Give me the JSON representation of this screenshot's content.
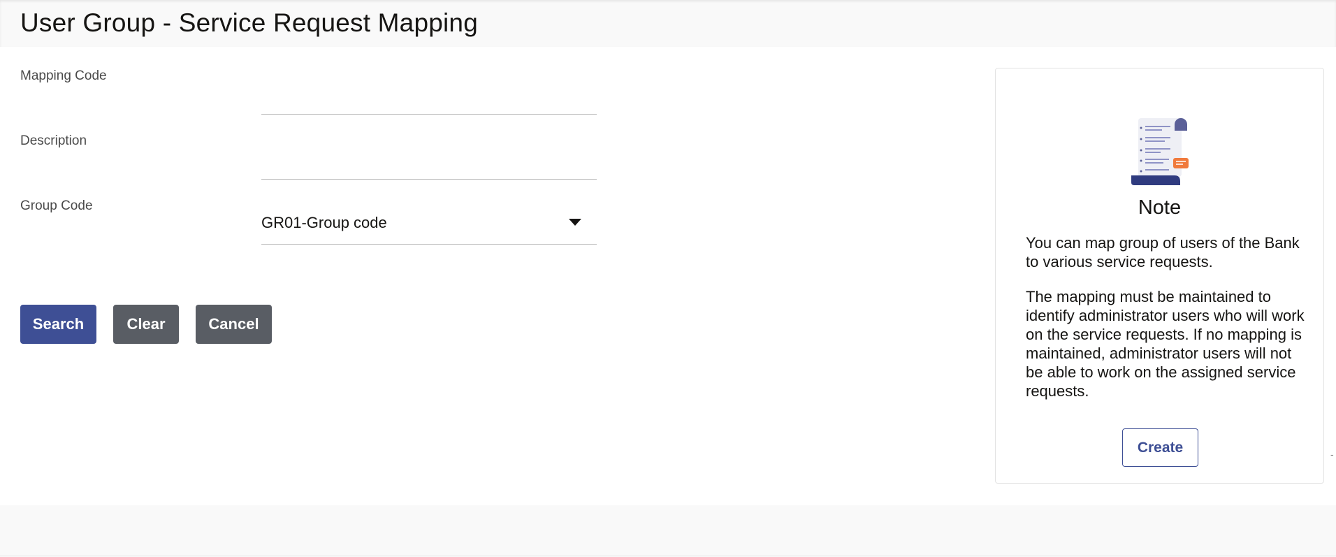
{
  "page": {
    "title": "User Group - Service Request Mapping"
  },
  "form": {
    "mapping_code_label": "Mapping Code",
    "mapping_code_value": "",
    "description_label": "Description",
    "description_value": "",
    "group_code_label": "Group Code",
    "group_code_value": "GR01-Group code"
  },
  "actions": {
    "search_label": "Search",
    "clear_label": "Clear",
    "cancel_label": "Cancel"
  },
  "note": {
    "title": "Note",
    "paragraph_1": "You can map group of users of the Bank to various service requests.",
    "paragraph_2": "The mapping must be maintained to identify administrator users who will work on the service requests. If no mapping is maintained, administrator users will not be able to work on the assigned service requests.",
    "create_label": "Create",
    "illustration": "document-list-icon"
  },
  "colors": {
    "primary": "#3e4f95",
    "secondary": "#595d64",
    "accent": "#f07a3c",
    "header_bg": "#f9f9f9"
  },
  "edge_marker": "-"
}
